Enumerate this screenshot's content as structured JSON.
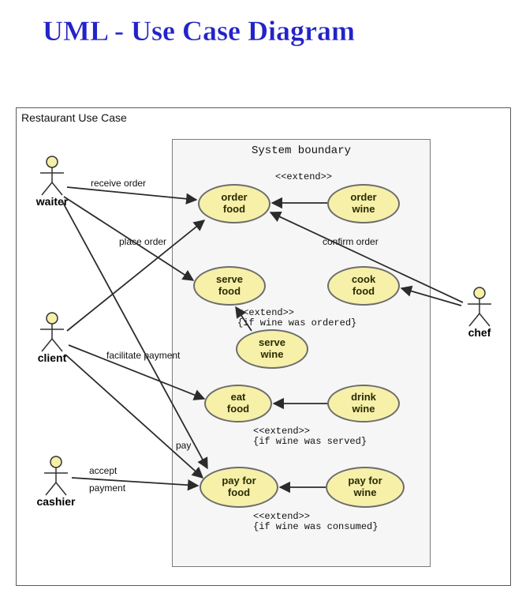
{
  "title": "UML - Use Case Diagram",
  "frame_label": "Restaurant Use Case",
  "system_boundary_label": "System boundary",
  "actors": {
    "waiter": "waiter",
    "client": "client",
    "chef": "chef",
    "cashier": "cashier"
  },
  "usecases": {
    "order_food": "order\nfood",
    "order_wine": "order\nwine",
    "serve_food": "serve\nfood",
    "cook_food": "cook\nfood",
    "serve_wine": "serve\nwine",
    "eat_food": "eat\nfood",
    "drink_wine": "drink\nwine",
    "pay_for_food": "pay for\nfood",
    "pay_for_wine": "pay for\nwine"
  },
  "assoc_labels": {
    "receive_order": "receive order",
    "place_order": "place order",
    "confirm_order": "confirm order",
    "facilitate_payment": "facilitate payment",
    "pay": "pay",
    "accept_payment_l1": "accept",
    "accept_payment_l2": "payment"
  },
  "extend_labels": {
    "extend": "<<extend>>",
    "if_ordered": "{if wine was ordered}",
    "if_served": "{if wine was served}",
    "if_consumed": "{if wine was consumed}"
  }
}
